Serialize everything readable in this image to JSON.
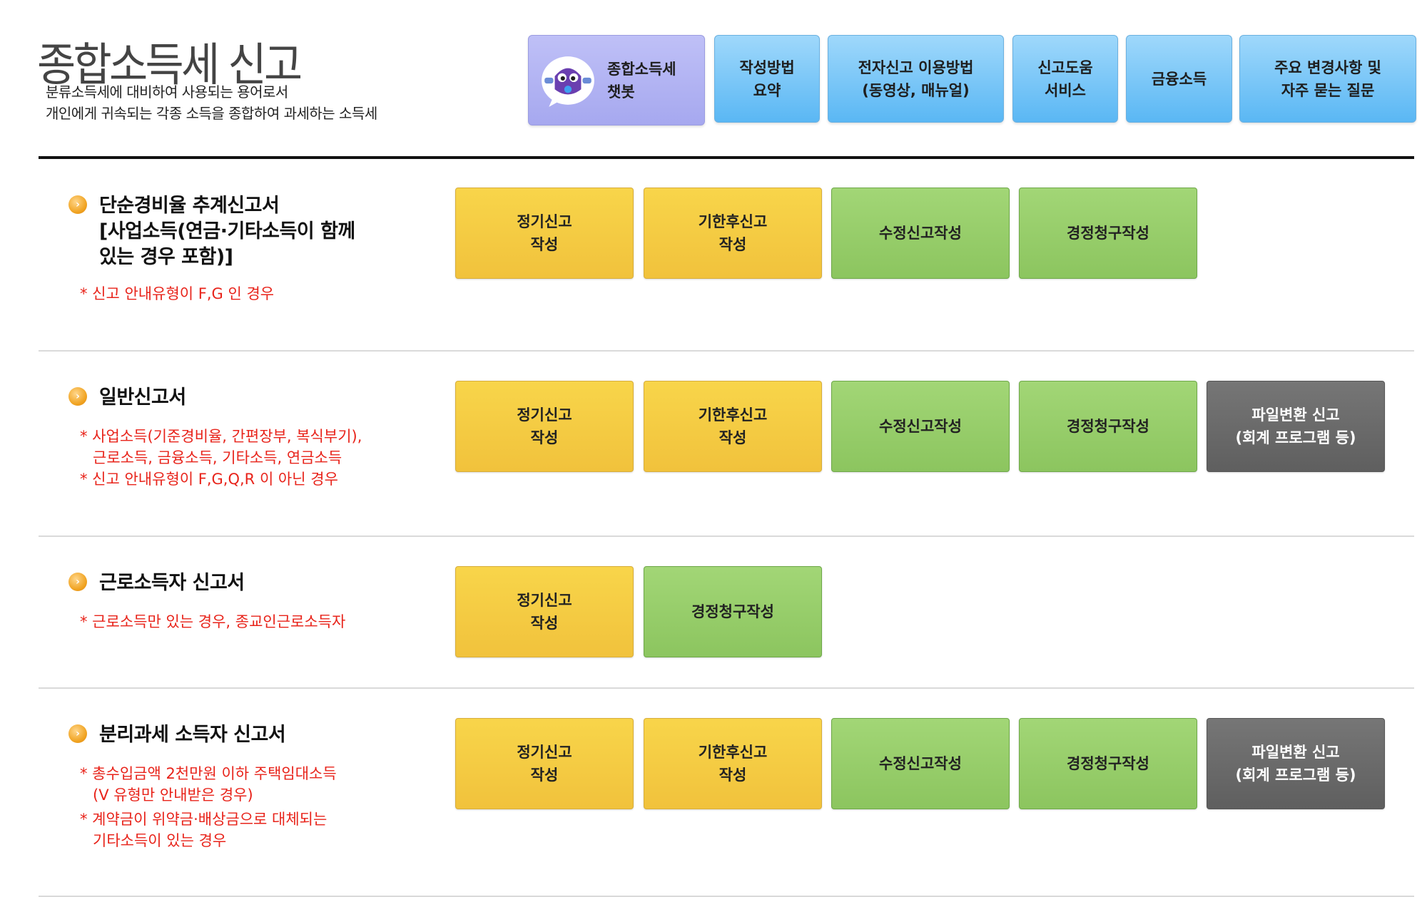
{
  "header": {
    "title": "종합소득세 신고",
    "subtitle_lines": [
      "분류소득세에 대비하여 사용되는 용어로서",
      "개인에게 귀속되는 각종 소득을 종합하여 과세하는 소득세"
    ]
  },
  "topnav": {
    "chatbot": "종합소득세\n챗봇",
    "summary": "작성방법\n요약",
    "e_filing": "전자신고 이용방법\n(동영상, 매뉴얼)",
    "help_service": "신고도움\n서비스",
    "financial": "금융소득",
    "faq": "주요 변경사항 및\n자주 묻는 질문"
  },
  "sections": [
    {
      "title": "단순경비율 추계신고서\n[사업소득(연금·기타소득이 함께\n있는 경우 포함)]",
      "notes": [
        "* 신고 안내유형이 F,G 인 경우"
      ],
      "buttons": [
        "정기신고\n작성",
        "기한후신고\n작성",
        "수정신고작성",
        "경정청구작성"
      ]
    },
    {
      "title": "일반신고서",
      "notes": [
        "* 사업소득(기준경비율, 간편장부, 복식부기),\n근로소득, 금융소득, 기타소득, 연금소득",
        "* 신고 안내유형이 F,G,Q,R 이 아닌 경우"
      ],
      "buttons": [
        "정기신고\n작성",
        "기한후신고\n작성",
        "수정신고작성",
        "경정청구작성",
        "파일변환 신고\n(회계 프로그램 등)"
      ]
    },
    {
      "title": "근로소득자 신고서",
      "notes": [
        "* 근로소득만 있는 경우, 종교인근로소득자"
      ],
      "buttons": [
        "정기신고\n작성",
        "경정청구작성"
      ]
    },
    {
      "title": "분리과세 소득자 신고서",
      "notes": [
        "* 총수입금액 2천만원 이하 주택임대소득\n(V 유형만 안내받은 경우)",
        "* 계약금이 위약금·배상금으로 대체되는\n기타소득이 있는 경우"
      ],
      "buttons": [
        "정기신고\n작성",
        "기한후신고\n작성",
        "수정신고작성",
        "경정청구작성",
        "파일변환 신고\n(회계 프로그램 등)"
      ]
    }
  ],
  "colors": {
    "nav_blue": "#6cc0f6",
    "chat_purple": "#b3b4f4",
    "btn_yellow": "#f4c942",
    "btn_green": "#95cc68",
    "btn_gray": "#676767",
    "note_red": "#e8231a"
  },
  "icons": {
    "bullet": "chevron-right-circle-icon",
    "chatbot": "chatbot-mascot-icon"
  }
}
